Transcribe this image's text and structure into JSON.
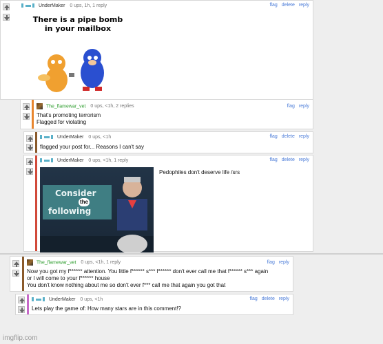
{
  "comments": [
    {
      "user": "UnderMaker",
      "meta": "0 ups, 1h, 1 reply",
      "actions": [
        "flag",
        "delete",
        "reply"
      ],
      "image_caption": "There is a pipe bomb\nin your mailbox"
    },
    {
      "user": "The_flamewar_vet",
      "meta": "0 ups, <1h, 2 replies",
      "actions": [
        "flag",
        "reply"
      ],
      "text": "That's promoting terrorism\nFlagged for violating"
    },
    {
      "user": "UnderMaker",
      "meta": "0 ups, <1h",
      "actions": [
        "flag",
        "delete",
        "reply"
      ],
      "text": "flagged your post for... Reasons I can't say"
    },
    {
      "user": "UnderMaker",
      "meta": "0 ups, <1h, 1 reply",
      "actions": [
        "flag",
        "delete",
        "reply"
      ],
      "text": "Pedophiles don't deserve life /srs",
      "image_text": [
        "Consider",
        "the",
        "following"
      ]
    },
    {
      "user": "The_flamewar_vet",
      "meta": "0 ups, <1h, 1 reply",
      "actions": [
        "flag",
        "reply"
      ],
      "text": "Now you got my f****** attention. You little f****** s*** f****** don't ever call me that f****** s*** again\nor I will come to your f****** house\nYou don't know nothing about me so don't ever f*** call me that again you got that"
    },
    {
      "user": "UnderMaker",
      "meta": "0 ups, <1h",
      "actions": [
        "flag",
        "delete",
        "reply"
      ],
      "text": "Lets play the game of: How many stars are in this comment!?"
    }
  ],
  "watermark": "imgflip.com",
  "colors": {
    "link": "#4a7bd8",
    "stripe_orange": "#e8862e",
    "stripe_brown": "#8a5a2b",
    "stripe_red": "#d24a3a",
    "stripe_purple": "#c768c9",
    "username_green": "#2f9e2f"
  }
}
